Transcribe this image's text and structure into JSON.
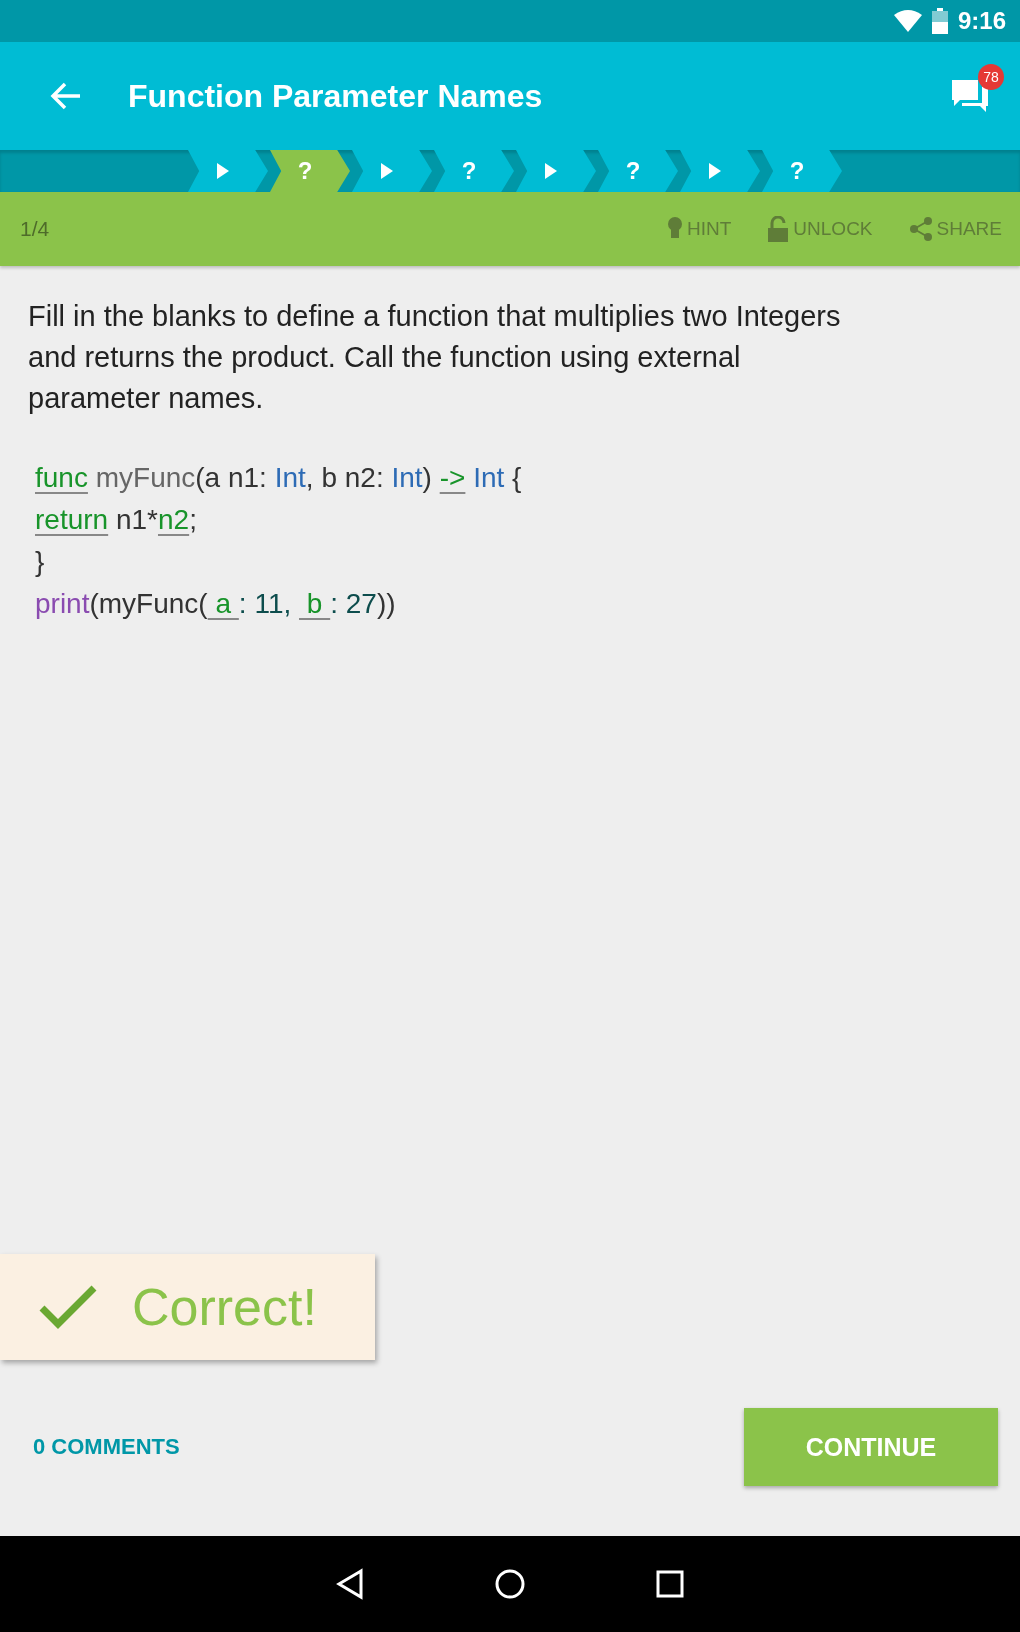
{
  "status_bar": {
    "time": "9:16"
  },
  "app_bar": {
    "title": "Function Parameter Names",
    "badge": "78"
  },
  "steps": [
    {
      "kind": "lesson",
      "selected": false
    },
    {
      "kind": "quiz",
      "label": "?",
      "selected": true
    },
    {
      "kind": "lesson",
      "selected": false
    },
    {
      "kind": "quiz",
      "label": "?",
      "selected": false
    },
    {
      "kind": "lesson",
      "selected": false
    },
    {
      "kind": "quiz",
      "label": "?",
      "selected": false
    },
    {
      "kind": "lesson",
      "selected": false
    },
    {
      "kind": "quiz",
      "label": "?",
      "selected": false
    }
  ],
  "toolbar": {
    "counter": "1/4",
    "actions": [
      {
        "kind": "hint",
        "label": "HINT"
      },
      {
        "kind": "unlock",
        "label": "UNLOCK"
      },
      {
        "kind": "share",
        "label": "SHARE"
      }
    ]
  },
  "question": "Fill in the blanks to define a function that multiplies two Integers and returns the product. Call the function using external parameter names.",
  "code_lines": [
    [
      {
        "text": "func",
        "kind": "blank"
      },
      {
        "text": " myFunc",
        "kind": "name"
      },
      {
        "text": "(a n1: ",
        "kind": "plain"
      },
      {
        "text": "Int",
        "kind": "type"
      },
      {
        "text": ", b n2: ",
        "kind": "plain"
      },
      {
        "text": "Int",
        "kind": "type"
      },
      {
        "text": ") ",
        "kind": "plain"
      },
      {
        "text": "->",
        "kind": "blank"
      },
      {
        "text": " Int",
        "kind": "type"
      },
      {
        "text": " {",
        "kind": "plain"
      }
    ],
    [
      {
        "text": "return",
        "kind": "blank"
      },
      {
        "text": " n1*",
        "kind": "plain"
      },
      {
        "text": "n2",
        "kind": "blank"
      },
      {
        "text": ";",
        "kind": "plain"
      }
    ],
    [
      {
        "text": "}",
        "kind": "plain"
      }
    ],
    [
      {
        "text": "print",
        "kind": "builtin"
      },
      {
        "text": "(myFunc(",
        "kind": "plain"
      },
      {
        "text": " a ",
        "kind": "blank"
      },
      {
        "text": ": 11, ",
        "kind": "number"
      },
      {
        "text": " b ",
        "kind": "blank"
      },
      {
        "text": ": 27",
        "kind": "number"
      },
      {
        "text": "))",
        "kind": "plain"
      }
    ]
  ],
  "result": {
    "kind": "correct",
    "message": "Correct!"
  },
  "comments_link": "0 COMMENTS",
  "continue_button": "CONTINUE"
}
